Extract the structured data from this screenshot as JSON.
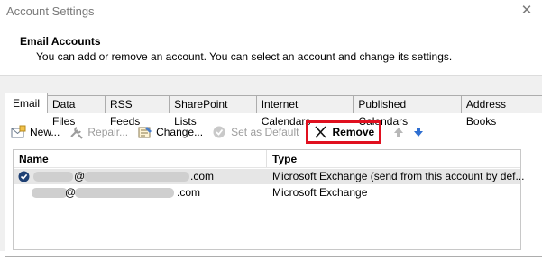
{
  "window": {
    "title": "Account Settings"
  },
  "header": {
    "section_title": "Email Accounts",
    "description": "You can add or remove an account. You can select an account and change its settings."
  },
  "tabs": [
    {
      "label": "Email",
      "active": true
    },
    {
      "label": "Data Files"
    },
    {
      "label": "RSS Feeds"
    },
    {
      "label": "SharePoint Lists"
    },
    {
      "label": "Internet Calendars"
    },
    {
      "label": "Published Calendars"
    },
    {
      "label": "Address Books"
    }
  ],
  "toolbar": {
    "new_label": "New...",
    "repair_label": "Repair...",
    "change_label": "Change...",
    "set_default_label": "Set as Default",
    "remove_label": "Remove",
    "highlight_color": "#e0101f"
  },
  "list": {
    "columns": [
      "Name",
      "Type"
    ],
    "rows": [
      {
        "at": "@",
        "domain_suffix": ".com",
        "type": "Microsoft Exchange (send from this account by def...",
        "default": true
      },
      {
        "at": "@",
        "domain_suffix": ".com",
        "type": "Microsoft Exchange",
        "default": false
      }
    ]
  }
}
